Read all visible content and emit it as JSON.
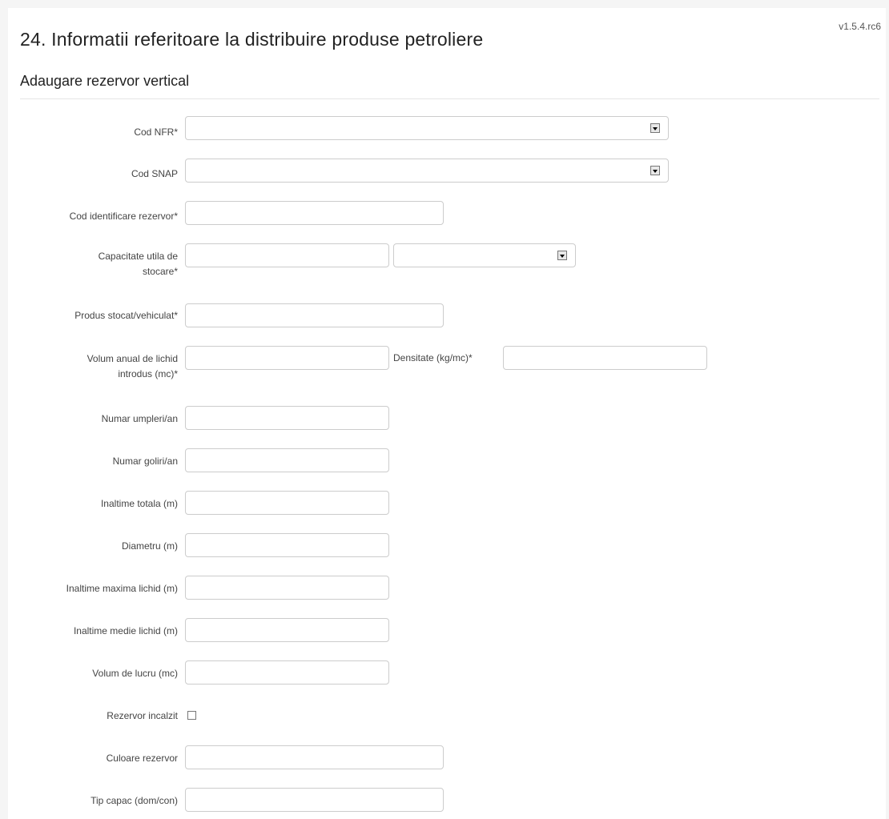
{
  "app": {
    "version": "v1.5.4.rc6"
  },
  "page": {
    "title": "24. Informatii referitoare la distribuire produse petroliere",
    "subtitle": "Adaugare rezervor vertical"
  },
  "form": {
    "cod_nfr": {
      "label": "Cod NFR*",
      "value": ""
    },
    "cod_snap": {
      "label": "Cod SNAP",
      "value": ""
    },
    "cod_identificare": {
      "label": "Cod identificare rezervor*",
      "value": ""
    },
    "capacitate": {
      "label_line1": "Capacitate utila de",
      "label_line2": "stocare*",
      "value": "",
      "unit": ""
    },
    "produs": {
      "label": "Produs stocat/vehiculat*",
      "value": ""
    },
    "volum_anual": {
      "label_line1": "Volum anual de lichid",
      "label_line2": "introdus (mc)*",
      "value": ""
    },
    "densitate": {
      "label": "Densitate (kg/mc)*",
      "value": ""
    },
    "numar_umpleri": {
      "label": "Numar umpleri/an",
      "value": ""
    },
    "numar_goliri": {
      "label": "Numar goliri/an",
      "value": ""
    },
    "inaltime_totala": {
      "label": "Inaltime totala (m)",
      "value": ""
    },
    "diametru": {
      "label": "Diametru (m)",
      "value": ""
    },
    "inaltime_maxima": {
      "label": "Inaltime maxima lichid (m)",
      "value": ""
    },
    "inaltime_medie": {
      "label": "Inaltime medie lichid (m)",
      "value": ""
    },
    "volum_lucru": {
      "label": "Volum de lucru (mc)",
      "value": ""
    },
    "rezervor_incalzit": {
      "label": "Rezervor incalzit",
      "checked": false
    },
    "culoare": {
      "label": "Culoare rezervor",
      "value": ""
    },
    "tip_capac": {
      "label": "Tip capac (dom/con)",
      "value": ""
    }
  }
}
